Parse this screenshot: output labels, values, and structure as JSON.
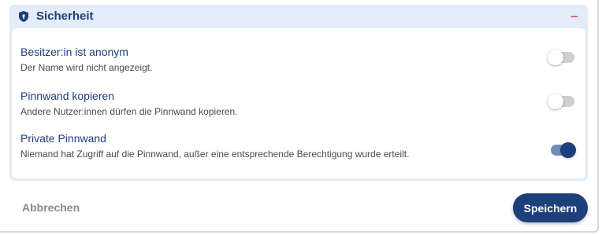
{
  "panel": {
    "title": "Sicherheit",
    "icon": "shield-icon",
    "collapse_icon": "minus-icon",
    "accent_color": "#1d3f7a",
    "collapse_color": "#c0283a",
    "background_color": "#e3ecf8"
  },
  "settings": [
    {
      "title": "Besitzer:in ist anonym",
      "description": "Der Name wird nicht angezeigt.",
      "enabled": false
    },
    {
      "title": "Pinnwand kopieren",
      "description": "Andere Nutzer:innen dürfen die Pinnwand kopieren.",
      "enabled": false
    },
    {
      "title": "Private Pinnwand",
      "description": "Niemand hat Zugriff auf die Pinnwand, außer eine entsprechende Berechtigung wurde erteilt.",
      "enabled": true
    }
  ],
  "footer": {
    "cancel_label": "Abbrechen",
    "save_label": "Speichern"
  }
}
